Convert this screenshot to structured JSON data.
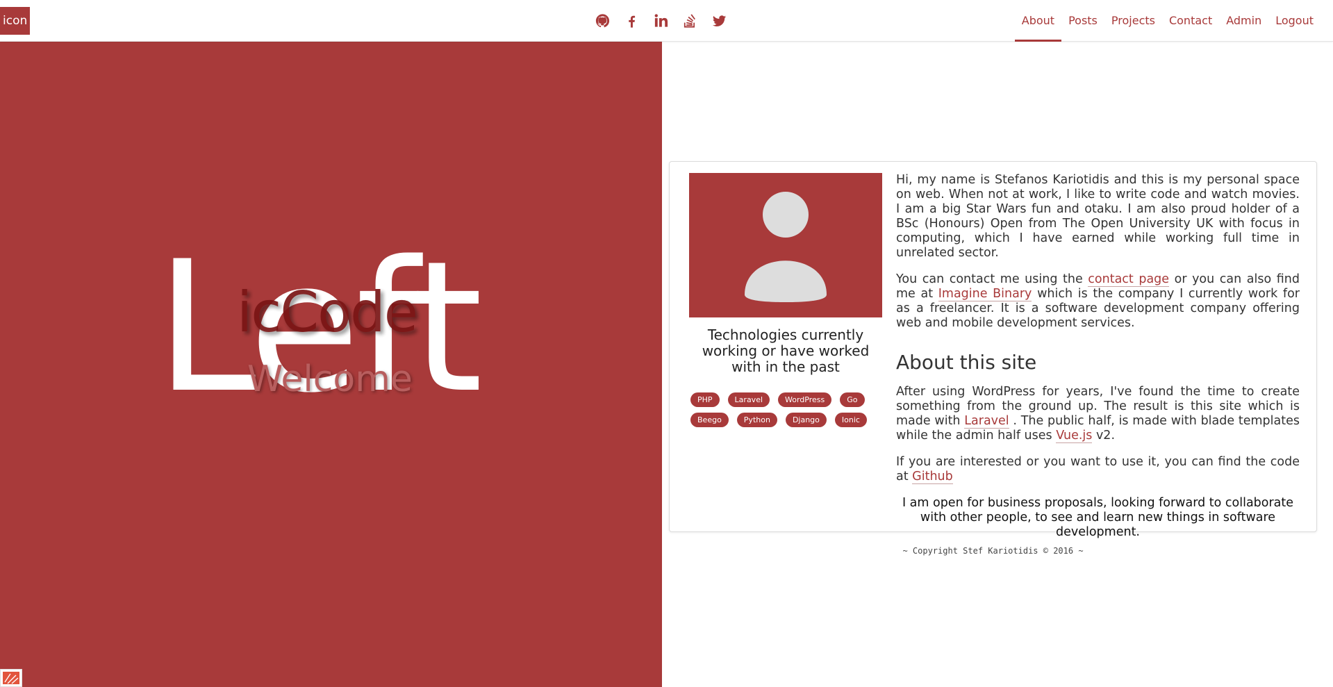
{
  "brand": {
    "label": "icon"
  },
  "social": [
    {
      "name": "github-icon"
    },
    {
      "name": "facebook-icon"
    },
    {
      "name": "linkedin-icon"
    },
    {
      "name": "stackoverflow-icon"
    },
    {
      "name": "twitter-icon"
    }
  ],
  "nav": {
    "about": "About",
    "posts": "Posts",
    "projects": "Projects",
    "contact": "Contact",
    "admin": "Admin",
    "logout": "Logout",
    "active": "About"
  },
  "hero": {
    "big": "Left",
    "code": "icCode",
    "welcome": "Welcome"
  },
  "profile": {
    "tech_heading": "Technologies currently working or have worked with in the past",
    "tags": [
      "PHP",
      "Laravel",
      "WordPress",
      "Go",
      "Beego",
      "Python",
      "Django",
      "Ionic"
    ]
  },
  "about": {
    "p1": "Hi, my name is Stefanos Kariotidis and this is my personal space on web. When not at work, I like to write code and watch movies. I am a big Star Wars fun and otaku. I am also proud holder of a BSc (Honours) Open from The Open University UK with focus in computing, which I have earned while working full time in unrelated sector.",
    "p2_a": "You can contact me using the ",
    "p2_link1": "contact page",
    "p2_b": " or you can also find me at ",
    "p2_link2": "Imagine Binary",
    "p2_c": " which is the company I currently work for as a freelancer. It is a software development company offering web and mobile development services.",
    "site_heading": "About this site",
    "p3_a": "After using WordPress for years, I've found the time to create something from the ground up. The result is this site which is made with ",
    "p3_link1": "Laravel",
    "p3_b": " . The public half, is made with blade templates while the admin half uses ",
    "p3_link2": "Vue.js",
    "p3_c": " v2.",
    "p4_a": "If you are interested or you want to use it, you can find the code at ",
    "p4_link": "Github",
    "closing": "I am open for business proposals, looking forward to collaborate with other people, to see and learn new things in software development."
  },
  "footer": {
    "copyright": "~ Copyright Stef Kariotidis © 2016 ~"
  },
  "colors": {
    "accent": "#a83a3a",
    "background": "#ffffff"
  }
}
